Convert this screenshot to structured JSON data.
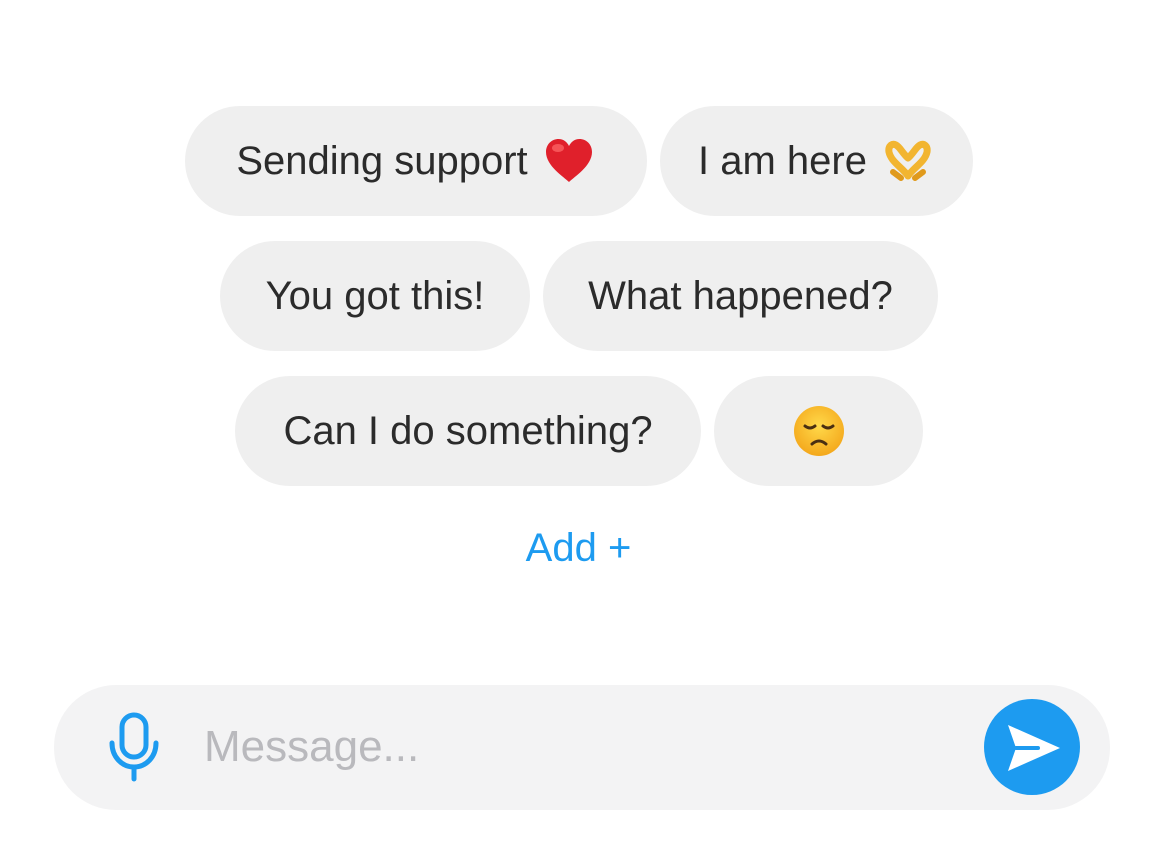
{
  "quick_replies": [
    {
      "label": "Sending support",
      "emoji": "red-heart"
    },
    {
      "label": "I am here",
      "emoji": "heart-hands"
    },
    {
      "label": "You got this!",
      "emoji": ""
    },
    {
      "label": "What happened?",
      "emoji": ""
    },
    {
      "label": "Can I do something?",
      "emoji": ""
    },
    {
      "label": "",
      "emoji": "disappointed-face"
    }
  ],
  "add_link": {
    "label": "Add +"
  },
  "composer": {
    "placeholder": "Message...",
    "value": "",
    "mic_icon": "microphone-icon",
    "send_icon": "send-icon"
  },
  "colors": {
    "accent": "#1d9bf0",
    "chip_background": "#efefef",
    "composer_background": "#f3f3f4",
    "placeholder": "#b9b9bd"
  }
}
